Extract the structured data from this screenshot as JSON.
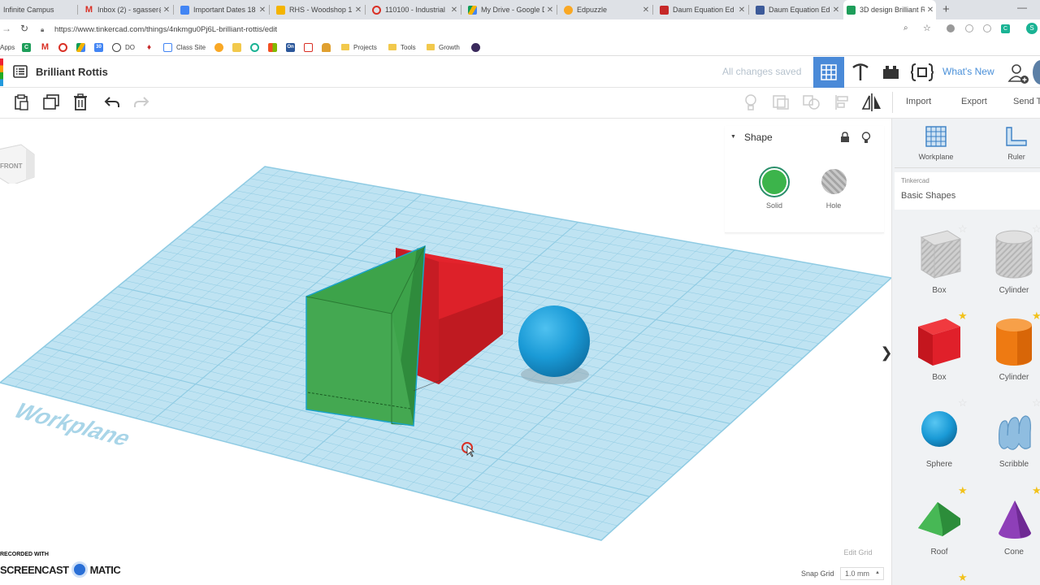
{
  "browser": {
    "tabs": [
      {
        "title": "Infinite Campus",
        "icon": "campus-icon",
        "color": "#2b6cb0"
      },
      {
        "title": "Inbox (2) - sgasser@",
        "icon": "gmail-icon",
        "color": "#d93025"
      },
      {
        "title": "Important Dates 18",
        "icon": "docs-icon",
        "color": "#4285f4"
      },
      {
        "title": "RHS - Woodshop 1",
        "icon": "slides-icon",
        "color": "#f4b400"
      },
      {
        "title": "110100 - Industrial",
        "icon": "target-icon",
        "color": "#d93025"
      },
      {
        "title": "My Drive - Google D",
        "icon": "drive-icon",
        "color": "#0f9d58"
      },
      {
        "title": "Edpuzzle",
        "icon": "edpuzzle-icon",
        "color": "#f9a825"
      },
      {
        "title": "Daum Equation Ed",
        "icon": "daum-icon",
        "color": "#c62828"
      },
      {
        "title": "Daum Equation Ed",
        "icon": "daum-doc-icon",
        "color": "#3c5a99"
      },
      {
        "title": "3D design Brilliant R",
        "icon": "tinkercad-icon",
        "color": "#1e9e5a"
      }
    ],
    "url": "https://www.tinkercad.com/things/4nkmgu0Pj6L-brilliant-rottis/edit",
    "bookmarks": {
      "apps_label": "Apps",
      "do_label": "DO",
      "class_site": "Class Site",
      "projects": "Projects",
      "tools": "Tools",
      "growth": "Growth"
    },
    "profile_initial": "S"
  },
  "app": {
    "design_title": "Brilliant Rottis",
    "save_status": "All changes saved",
    "whats_new": "What's New",
    "toolbar": {
      "import": "Import",
      "export": "Export",
      "send_to": "Send To"
    }
  },
  "viewcube": {
    "front_label": "FRONT"
  },
  "workplane_label": "Workplane",
  "shape_inspector": {
    "title": "Shape",
    "solid": "Solid",
    "hole": "Hole",
    "solid_color": "#3cb44b"
  },
  "right_panel": {
    "workplane": "Workplane",
    "ruler": "Ruler",
    "library_source": "Tinkercad",
    "library_name": "Basic Shapes",
    "shapes": [
      {
        "label": "Box",
        "style": "hole-gray"
      },
      {
        "label": "Cylinder",
        "style": "hole-gray"
      },
      {
        "label": "Box",
        "color": "#e0202a"
      },
      {
        "label": "Cylinder",
        "color": "#f07e14"
      },
      {
        "label": "Sphere",
        "color": "#1a9ad6"
      },
      {
        "label": "Scribble",
        "color": "#7fb2d9"
      },
      {
        "label": "Roof",
        "color": "#3aa845"
      },
      {
        "label": "Cone",
        "color": "#8a3fb5"
      }
    ]
  },
  "grid_controls": {
    "edit_grid": "Edit Grid",
    "snap_grid_label": "Snap Grid",
    "snap_grid_value": "1.0 mm"
  },
  "watermark": {
    "line1": "RECORDED WITH",
    "line2a": "SCREENCAST",
    "line2b": "MATIC"
  },
  "colors": {
    "workplane_fill": "#bfe3f2",
    "workplane_grid": "#8fcbe3",
    "red_box": "#e0202a",
    "green_roof": "#3aa845",
    "blue_sphere": "#1a9ad6",
    "accent_blue": "#4a8ad8"
  }
}
